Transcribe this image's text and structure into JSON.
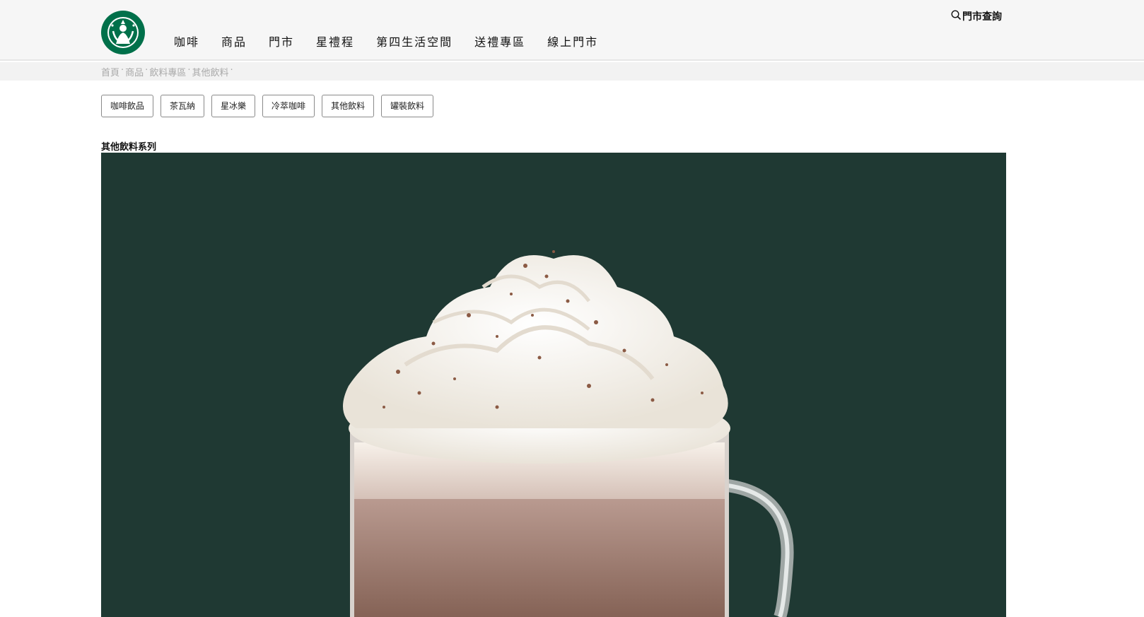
{
  "header": {
    "logo_icon": "starbucks-siren-logo",
    "nav": [
      "咖啡",
      "商品",
      "門市",
      "星禮程",
      "第四生活空間",
      "送禮專區",
      "線上門市"
    ],
    "store_search_label": "門市查詢",
    "store_search_icon": "search-icon"
  },
  "breadcrumb": [
    "首頁",
    "商品",
    "飲料專區",
    "其他飲料"
  ],
  "filters": [
    "咖啡飲品",
    "茶瓦納",
    "星冰樂",
    "冷萃咖啡",
    "其他飲料",
    "罐裝飲料"
  ],
  "section": {
    "title": "其他飲料系列",
    "hero_image": "hot-chocolate-with-whipped-cream"
  },
  "colors": {
    "brand_green": "#00704a",
    "hero_background": "#1f3933",
    "header_background": "#f6f6f6"
  }
}
